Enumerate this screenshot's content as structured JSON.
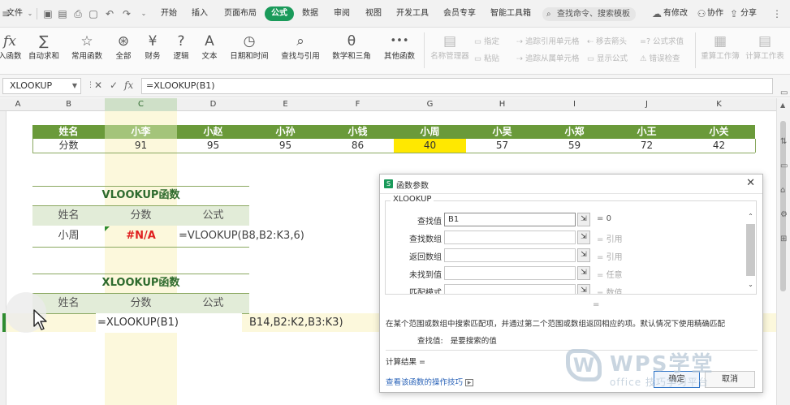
{
  "menubar": {
    "file": "文件",
    "tabs": [
      {
        "label": "开始",
        "active": false
      },
      {
        "label": "插入",
        "active": false
      },
      {
        "label": "页面布局",
        "active": false
      },
      {
        "label": "公式",
        "active": true
      },
      {
        "label": "数据",
        "active": false
      },
      {
        "label": "审阅",
        "active": false
      },
      {
        "label": "视图",
        "active": false
      },
      {
        "label": "开发工具",
        "active": false
      },
      {
        "label": "会员专享",
        "active": false
      },
      {
        "label": "智能工具箱",
        "active": false
      }
    ],
    "search_label": "查找命令、搜索模板",
    "modified_label": "有修改",
    "collab_label": "协作",
    "share_label": "分享"
  },
  "ribbon": {
    "buttons": [
      {
        "label": "入函数",
        "icon": "fx"
      },
      {
        "label": "自动求和",
        "icon": "∑"
      },
      {
        "label": "常用函数",
        "icon": "☆"
      },
      {
        "label": "全部",
        "icon": "⊛"
      },
      {
        "label": "财务",
        "icon": "¥"
      },
      {
        "label": "逻辑",
        "icon": "?"
      },
      {
        "label": "文本",
        "icon": "A"
      },
      {
        "label": "日期和时间",
        "icon": "◷"
      },
      {
        "label": "查找与引用",
        "icon": "⌕"
      },
      {
        "label": "数学和三角",
        "icon": "θ"
      },
      {
        "label": "其他函数",
        "icon": "•••"
      }
    ],
    "name_manager": "名称管理器",
    "assign": "指定",
    "paste": "粘贴",
    "trace_precedents": "追踪引用单元格",
    "trace_dependents": "追踪从属单元格",
    "remove_arrows": "移去箭头",
    "show_formulas": "显示公式",
    "formula_eval": "=? 公式求值",
    "error_check": "错误检查",
    "recalc_workbook": "重算工作簿",
    "calc_sheet": "计算工作表"
  },
  "formula_bar": {
    "name_box": "XLOOKUP",
    "fx_label": "fx",
    "formula": "=XLOOKUP(B1)"
  },
  "columns": [
    "A",
    "B",
    "C",
    "D",
    "E",
    "F",
    "G",
    "H",
    "I",
    "J",
    "K"
  ],
  "top_table": {
    "header_label": "姓名",
    "names": [
      "小李",
      "小赵",
      "小孙",
      "小钱",
      "小周",
      "小吴",
      "小郑",
      "小王",
      "小关"
    ],
    "score_label": "分数",
    "scores": [
      "91",
      "95",
      "95",
      "86",
      "40",
      "57",
      "59",
      "72",
      "42"
    ],
    "highlight_color": "#ffe800"
  },
  "vlookup_table": {
    "title": "VLOOKUP函数",
    "headers": [
      "姓名",
      "分数",
      "公式"
    ],
    "name": "小周",
    "result": "#N/A",
    "formula": "=VLOOKUP(B8,B2:K3,6)"
  },
  "xlookup_table": {
    "title": "XLOOKUP函数",
    "headers": [
      "姓名",
      "分数",
      "公式"
    ],
    "editing_formula": "=XLOOKUP(B1)",
    "overflow_text": "B14,B2:K2,B3:K3)"
  },
  "dialog": {
    "title": "函数参数",
    "func_name": "XLOOKUP",
    "args": [
      {
        "label": "查找值",
        "value": "B1",
        "result": "0"
      },
      {
        "label": "查找数组",
        "value": "",
        "result": "引用"
      },
      {
        "label": "返回数组",
        "value": "",
        "result": "引用"
      },
      {
        "label": "未找到值",
        "value": "",
        "result": "任意"
      },
      {
        "label": "匹配模式",
        "value": "",
        "result": "数值"
      }
    ],
    "equals": "=",
    "description": "在某个范围或数组中搜索匹配项，并通过第二个范围或数组返回相应的项。默认情况下使用精确匹配",
    "param_name": "查找值:",
    "param_desc": "是要搜索的值",
    "calc_result": "计算结果 =",
    "help_link": "查看该函数的操作技巧",
    "ok": "确定",
    "cancel": "取消"
  },
  "watermark": {
    "logo": "W",
    "text": "WPS学堂",
    "sub": "office 技巧学习平台"
  },
  "colors": {
    "accent": "#1a9a5a",
    "table_header": "#6a9a3a",
    "error_red": "#e02020"
  }
}
